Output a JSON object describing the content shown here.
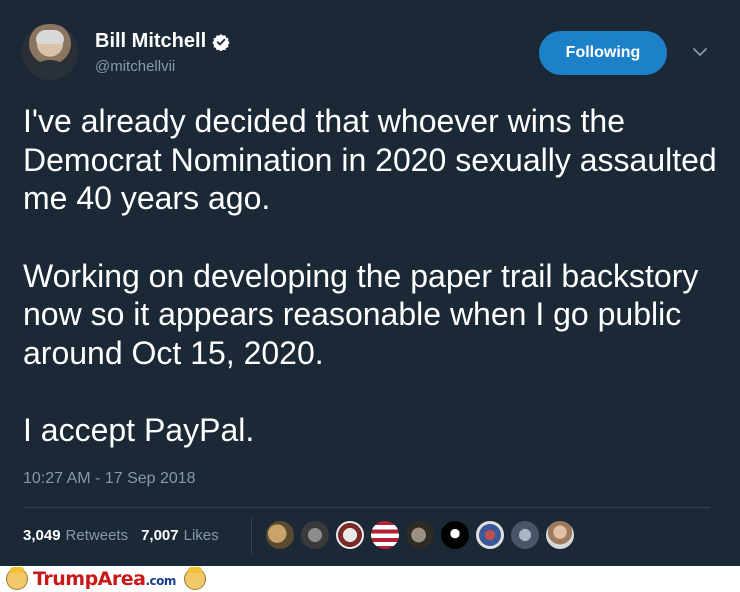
{
  "author": {
    "name": "Bill Mitchell",
    "handle": "@mitchellvii",
    "avatar_icon": "avatar-photo",
    "verified_icon": "verified-badge-icon"
  },
  "follow_button": {
    "label": "Following"
  },
  "menu_icon": "chevron-down-icon",
  "tweet": {
    "paragraphs": [
      "I've already decided that whoever wins the Democrat Nomination in 2020 sexually assaulted me 40 years ago.",
      "Working on developing the paper trail backstory now so it appears reasonable when I go public around Oct 15, 2020.",
      "I accept PayPal."
    ],
    "timestamp": "10:27 AM - 17 Sep 2018"
  },
  "stats": {
    "retweets_count": "3,049",
    "retweets_label": "Retweets",
    "likes_count": "7,007",
    "likes_label": "Likes"
  },
  "liker_avatars": [
    "liker-avatar-1",
    "liker-avatar-2",
    "liker-avatar-3",
    "liker-avatar-4",
    "liker-avatar-5",
    "liker-avatar-6",
    "liker-avatar-7",
    "liker-avatar-8",
    "liker-avatar-9"
  ],
  "colors": {
    "background": "#1b2836",
    "accent": "#1d81c9",
    "secondary_text": "#8899a6",
    "brand_red": "#c81818"
  },
  "watermark": {
    "brand": "TrumpArea",
    "suffix": ".com"
  }
}
